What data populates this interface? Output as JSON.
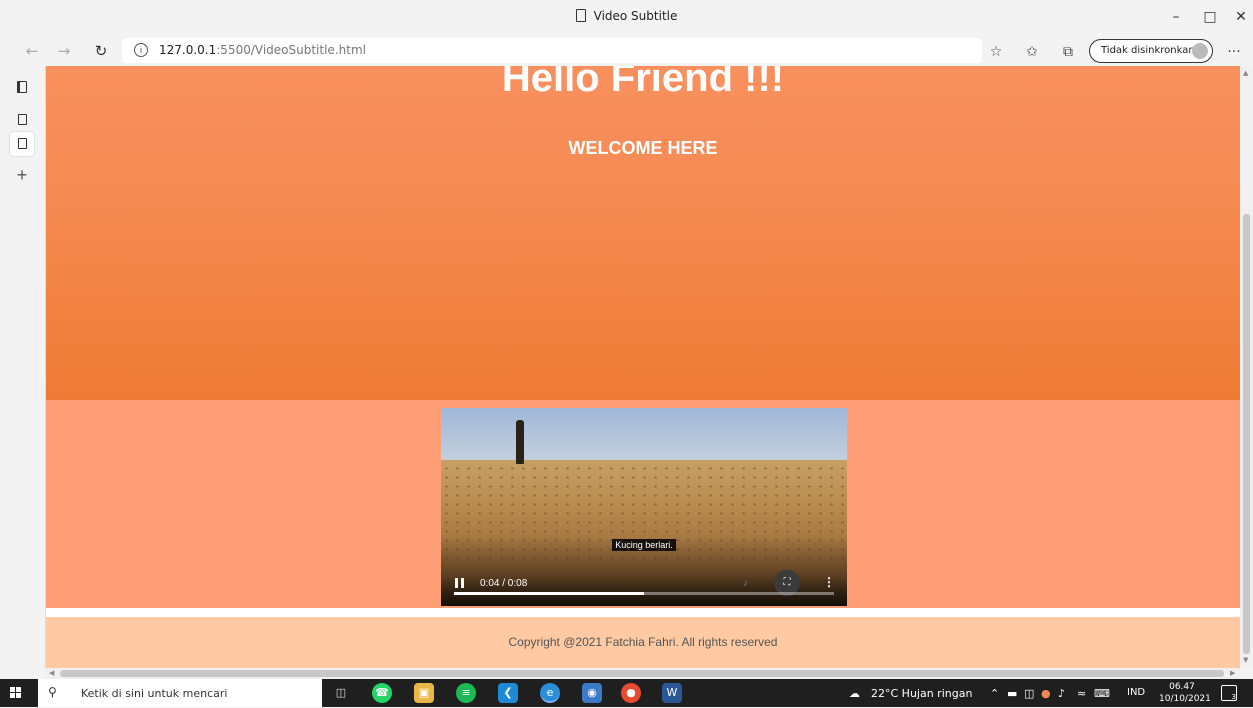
{
  "window": {
    "title": "Video Subtitle",
    "minimize": "–",
    "maximize": "□",
    "close": "✕"
  },
  "toolbar": {
    "url_host": "127.0.0.1",
    "url_rest": ":5500/VideoSubtitle.html",
    "sync_label": "Tidak disinkronkan",
    "more": "···"
  },
  "sidebar": {
    "add_tab": "+"
  },
  "page": {
    "heading": "Hello Friend !!!",
    "subheading": "WELCOME HERE",
    "footer": "Copyright @2021 Fatchia Fahri. All rights reserved"
  },
  "video": {
    "caption": "Kucing berlari.",
    "time": "0:04 / 0:08",
    "progress_fraction": 0.5
  },
  "taskbar": {
    "search_placeholder": "Ketik di sini untuk mencari",
    "weather": "22°C  Hujan ringan",
    "language": "IND",
    "time": "06.47",
    "date": "10/10/2021",
    "notification_count": "3"
  }
}
